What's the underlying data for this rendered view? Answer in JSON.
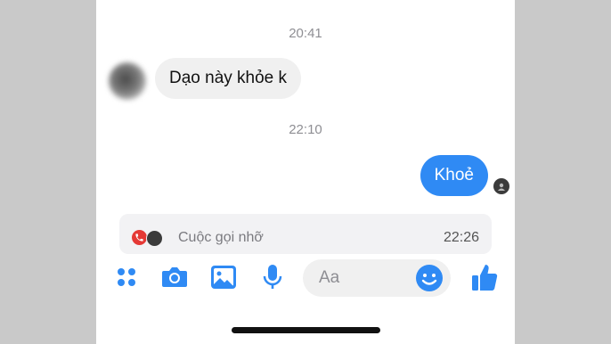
{
  "chat": {
    "timestamp_1": "20:41",
    "incoming_message": "Dạo này khỏe k",
    "timestamp_2": "22:10",
    "outgoing_message": "Khoẻ"
  },
  "missed_call": {
    "label": "Cuộc gọi nhỡ",
    "time": "22:26"
  },
  "composer": {
    "placeholder": "Aa",
    "icons": [
      "apps-icon",
      "camera-icon",
      "image-icon",
      "microphone-icon",
      "emoji-icon",
      "thumbs-up-icon"
    ]
  },
  "colors": {
    "accent": "#2f8af4",
    "incoming_bubble": "#f0f0f0",
    "missed_call": "#e53935"
  }
}
